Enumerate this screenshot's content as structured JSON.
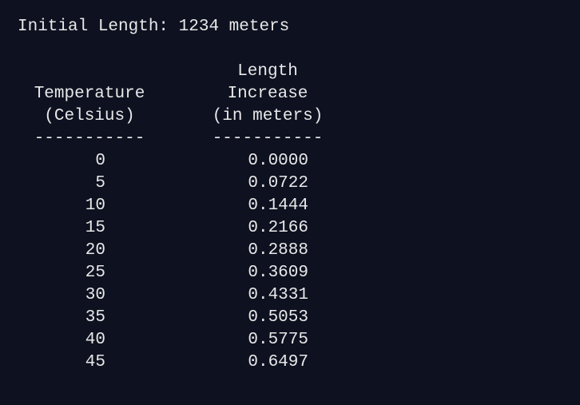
{
  "initial_line": "Initial Length: 1234 meters",
  "header": {
    "temperature": [
      "Temperature",
      "(Celsius)"
    ],
    "length": [
      "Length",
      "Increase",
      "(in meters)"
    ],
    "separator_temp": "-----------",
    "separator_len": "-----------"
  },
  "rows": [
    {
      "temperature": "0",
      "increase": "0.0000"
    },
    {
      "temperature": "5",
      "increase": "0.0722"
    },
    {
      "temperature": "10",
      "increase": "0.1444"
    },
    {
      "temperature": "15",
      "increase": "0.2166"
    },
    {
      "temperature": "20",
      "increase": "0.2888"
    },
    {
      "temperature": "25",
      "increase": "0.3609"
    },
    {
      "temperature": "30",
      "increase": "0.4331"
    },
    {
      "temperature": "35",
      "increase": "0.5053"
    },
    {
      "temperature": "40",
      "increase": "0.5775"
    },
    {
      "temperature": "45",
      "increase": "0.6497"
    }
  ]
}
